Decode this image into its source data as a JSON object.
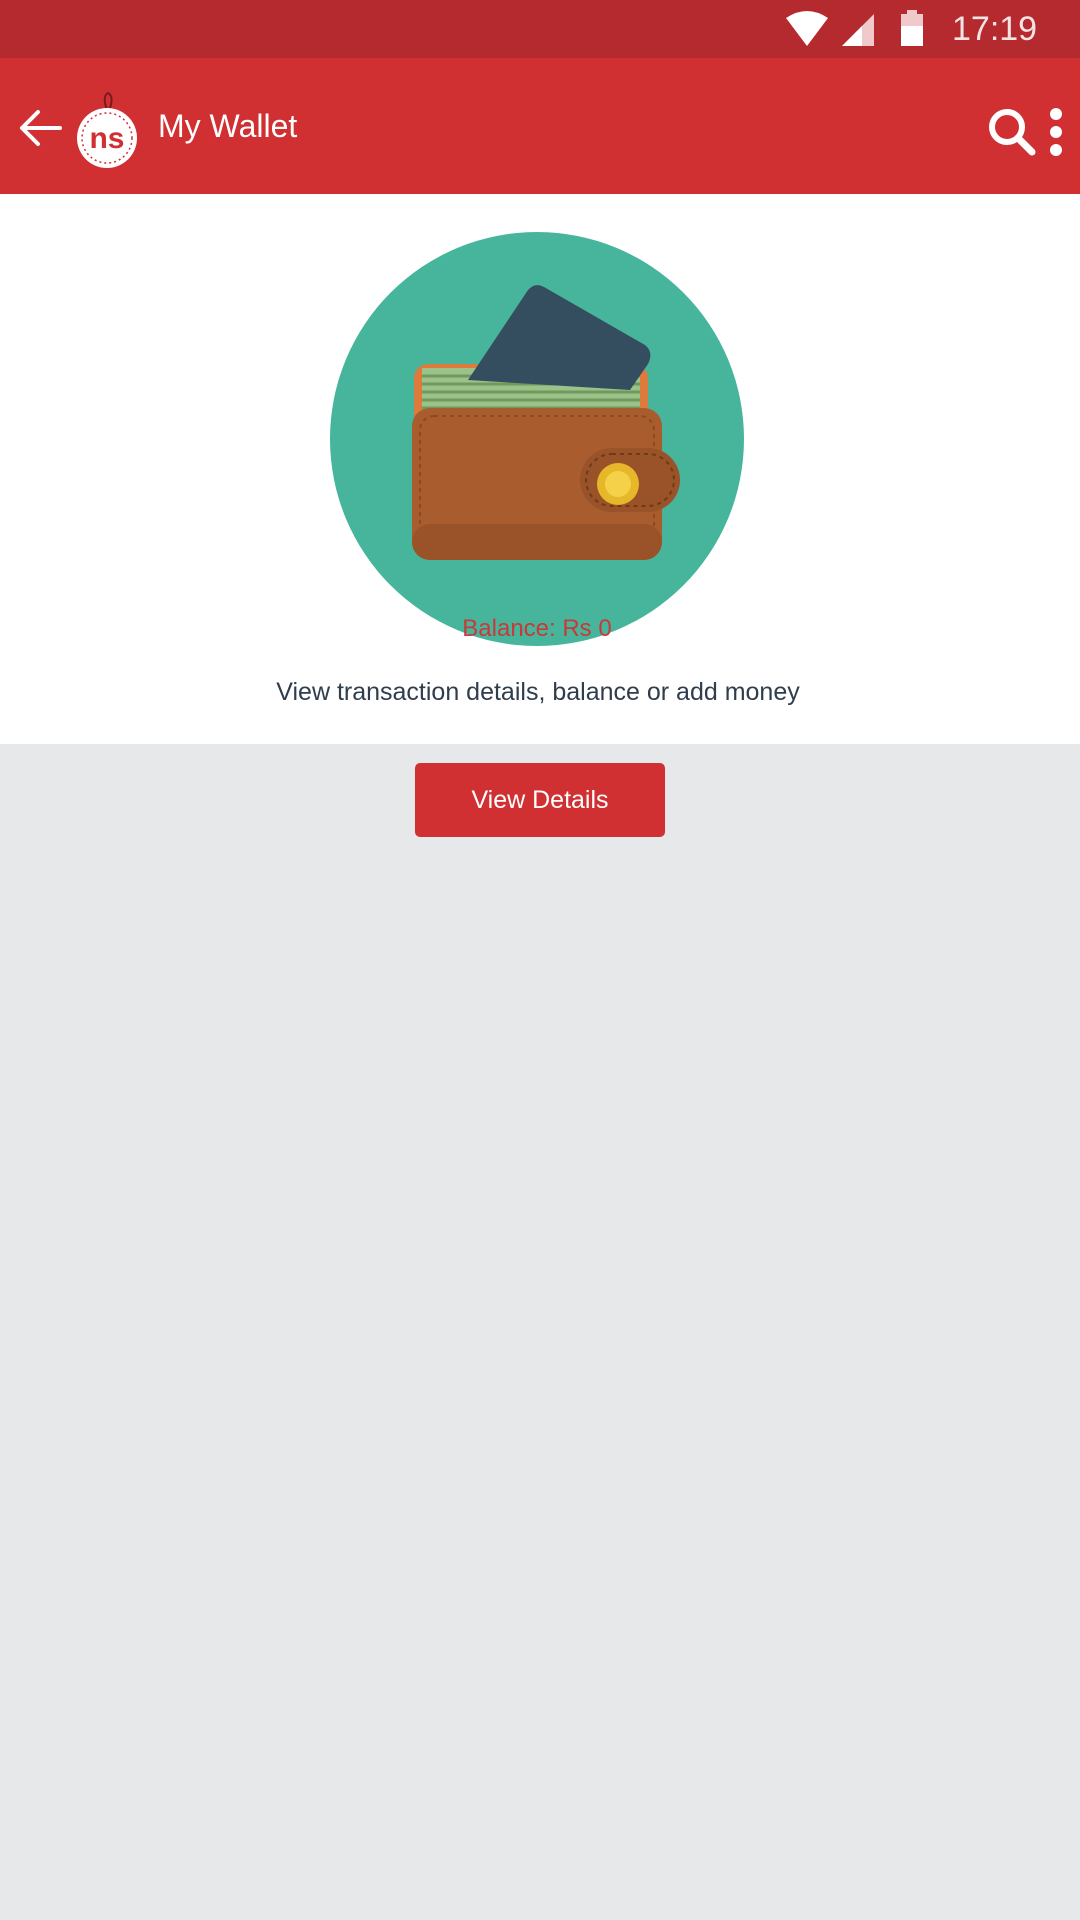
{
  "status_bar": {
    "time": "17:19",
    "icons": [
      "wifi-icon",
      "cell-signal-icon",
      "battery-icon"
    ]
  },
  "app_bar": {
    "title": "My Wallet",
    "logo_text": "ns",
    "icons": [
      "back-arrow-icon",
      "search-icon",
      "more-vertical-icon"
    ]
  },
  "wallet": {
    "balance_label": "Balance: Rs 0",
    "description": "View transaction details, balance or add money"
  },
  "actions": {
    "view_details_label": "View Details"
  },
  "colors": {
    "status_bar": "#b52a2e",
    "app_bar": "#d13033",
    "button": "#d13033",
    "circle": "#47b59c",
    "page_background": "#e7e8ea",
    "balance_text": "#c8393a",
    "description_text": "#2f3d4c"
  }
}
